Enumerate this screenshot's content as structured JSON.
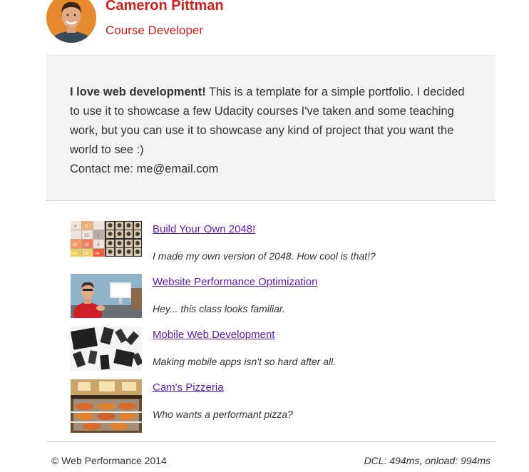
{
  "header": {
    "name": "Cameron Pittman",
    "role": "Course Developer"
  },
  "intro": {
    "lead": "I love web development!",
    "body": " This is a template for a simple portfolio. I decided to use it to showcase a few Udacity courses I've taken and some teaching work, but you can use it to showcase any kind of project that you want the world to see :)",
    "contact": "Contact me: me@email.com"
  },
  "projects": [
    {
      "title": "Build Your Own 2048!",
      "description": "I made my own version of 2048. How cool is that!?",
      "thumbnail": "2048-grid"
    },
    {
      "title": "Website Performance Optimization",
      "description": "Hey... this class looks familiar.",
      "thumbnail": "instructor-photo"
    },
    {
      "title": "Mobile Web Development",
      "description": "Making mobile apps isn't so hard after all.",
      "thumbnail": "mobile-devices-photo"
    },
    {
      "title": "Cam's Pizzeria",
      "description": "Who wants a performant pizza?",
      "thumbnail": "pizzeria-photo"
    }
  ],
  "footer": {
    "copyright": "© Web Performance 2014",
    "perf": "DCL: 494ms, onload: 994ms"
  },
  "thumb_2048_tiles": [
    "4",
    "8",
    "32",
    "16",
    "4",
    "2",
    "256",
    "128",
    "64",
    "32"
  ],
  "colors": {
    "accent": "#cc1f1f",
    "link": "#5b1ea8",
    "intro_bg": "#f3f3f3",
    "divider": "#cfcfcf"
  }
}
